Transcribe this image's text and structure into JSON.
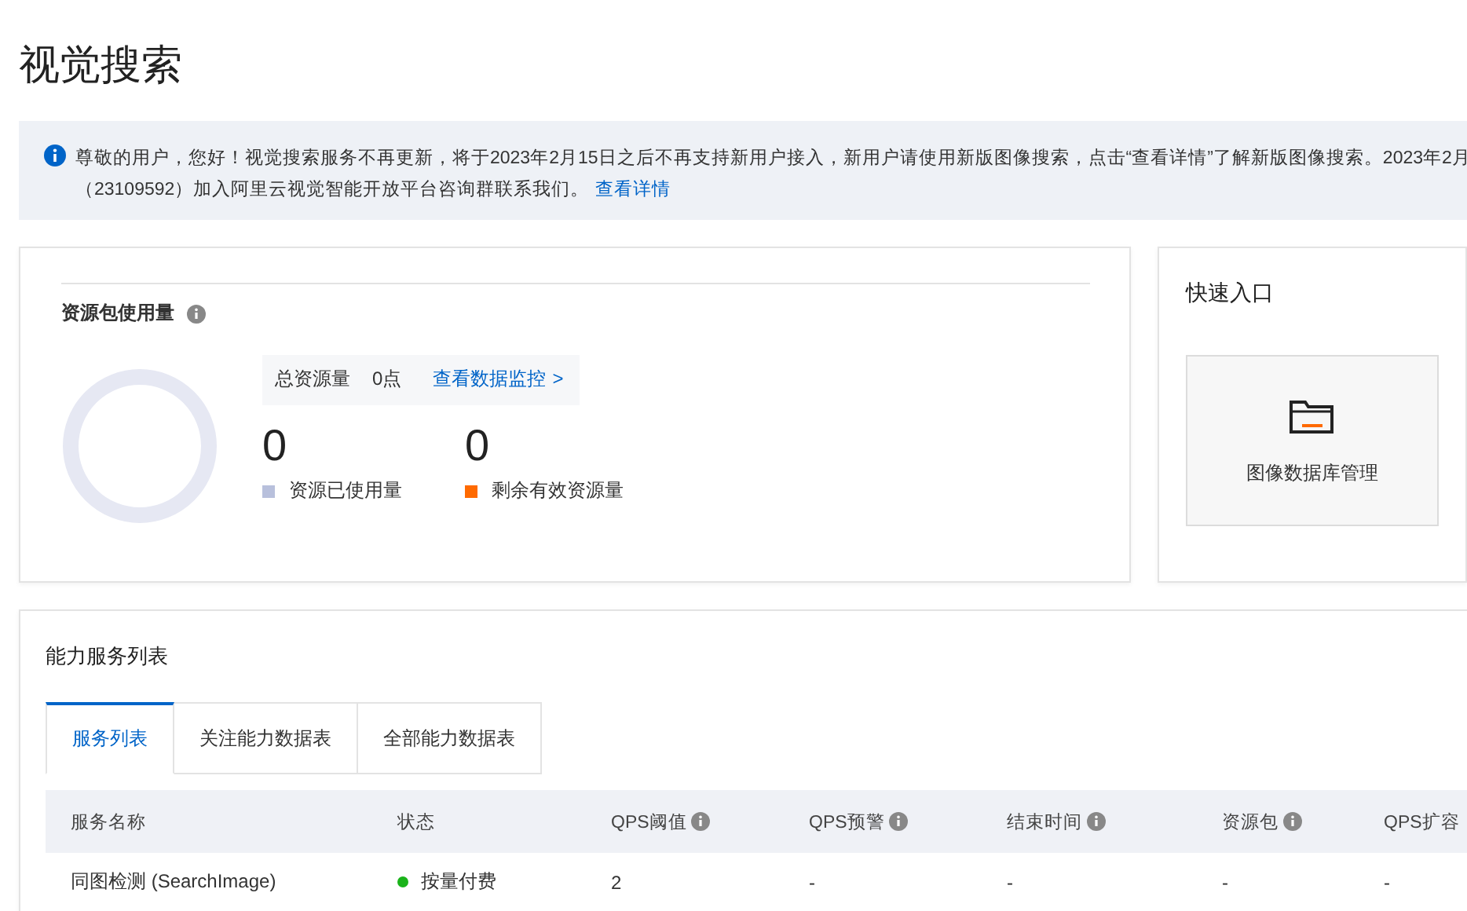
{
  "page_title": "视觉搜索",
  "notice": {
    "text": "尊敬的用户，您好！视觉搜索服务不再更新，将于2023年2月15日之后不再支持新用户接入，新用户请使用新版图像搜索，点击“查看详情”了解新版图像搜索。2023年2月",
    "text_line2": "（23109592）加入阿里云视觉智能开放平台咨询群联系我们。",
    "link": "查看详情"
  },
  "usage": {
    "title": "资源包使用量",
    "total_label": "总资源量",
    "total_value": "0点",
    "monitor_link": "查看数据监控",
    "monitor_arrow": ">",
    "stats": [
      {
        "value": "0",
        "label": "资源已使用量",
        "color": "#b8c0dc"
      },
      {
        "value": "0",
        "label": "剩余有效资源量",
        "color": "#ff6a00"
      }
    ]
  },
  "quick_entry": {
    "title": "快速入口",
    "items": [
      {
        "label": "图像数据库管理"
      }
    ]
  },
  "services": {
    "title": "能力服务列表",
    "tabs": [
      {
        "label": "服务列表",
        "selected": true
      },
      {
        "label": "关注能力数据表",
        "selected": false
      },
      {
        "label": "全部能力数据表",
        "selected": false
      }
    ],
    "columns": [
      {
        "label": "服务名称"
      },
      {
        "label": "状态"
      },
      {
        "label": "QPS阈值",
        "info": true
      },
      {
        "label": "QPS预警",
        "info": true
      },
      {
        "label": "结束时间",
        "info": true
      },
      {
        "label": "资源包",
        "info": true
      },
      {
        "label": "QPS扩容"
      }
    ],
    "rows": [
      {
        "cells": [
          "同图检测 (SearchImage)",
          "按量付费",
          "2",
          "-",
          "-",
          "-",
          "-"
        ]
      }
    ]
  }
}
